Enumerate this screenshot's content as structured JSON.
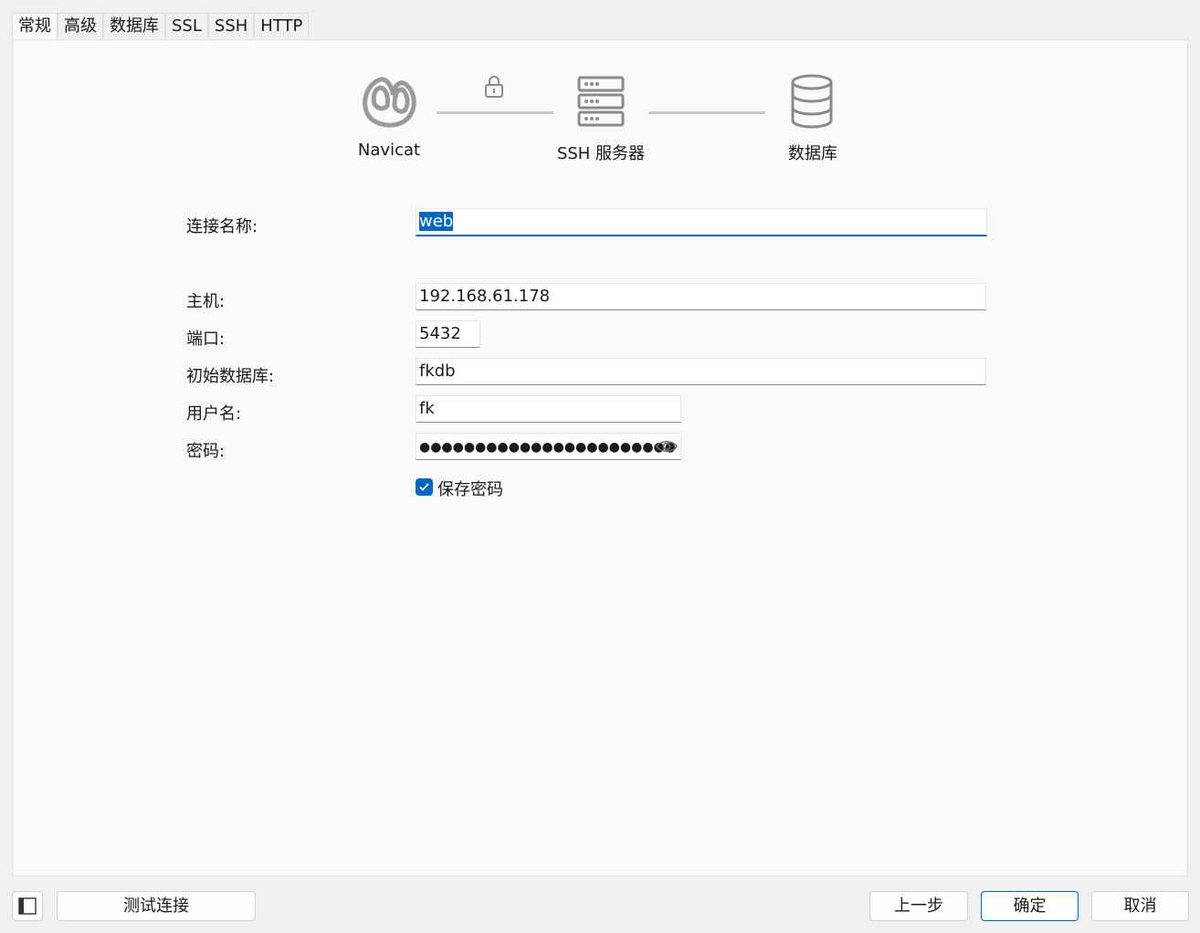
{
  "tabs": [
    {
      "label": "常规",
      "active": true
    },
    {
      "label": "高级"
    },
    {
      "label": "数据库"
    },
    {
      "label": "SSL"
    },
    {
      "label": "SSH"
    },
    {
      "label": "HTTP"
    }
  ],
  "diagram": {
    "navicat_label": "Navicat",
    "ssh_label": "SSH 服务器",
    "db_label": "数据库",
    "icons": [
      "navicat-logo-icon",
      "lock-icon",
      "server-icon",
      "database-icon"
    ]
  },
  "form": {
    "connection_name": {
      "label": "连接名称:",
      "value": "web"
    },
    "host": {
      "label": "主机:",
      "value": "192.168.61.178"
    },
    "port": {
      "label": "端口:",
      "value": "5432"
    },
    "initial_db": {
      "label": "初始数据库:",
      "value": "fkdb"
    },
    "username": {
      "label": "用户名:",
      "value": "fk"
    },
    "password": {
      "label": "密码:",
      "masked": "●●●●●●●●●●●●●●●●●●●●●●●"
    },
    "save_password": {
      "label": "保存密码",
      "checked": true
    }
  },
  "buttons": {
    "test": "测试连接",
    "back": "上一步",
    "ok": "确定",
    "cancel": "取消"
  },
  "colors": {
    "accent": "#0067c0",
    "panel": "#f9f9f9",
    "window": "#f0f0f0"
  }
}
